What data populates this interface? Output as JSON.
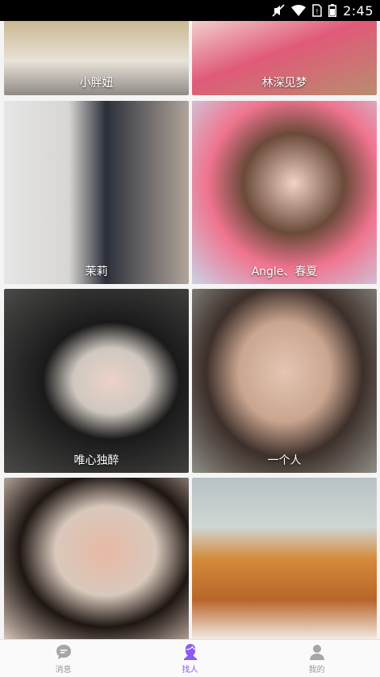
{
  "status_bar": {
    "time": "2:45",
    "icons": [
      "mute-icon",
      "wifi-icon",
      "no-sim-icon",
      "battery-icon"
    ]
  },
  "profiles": [
    {
      "name": "小胖妞",
      "photo_colors": [
        "#c9b68e",
        "#e8e2d8",
        "#8f8a86"
      ]
    },
    {
      "name": "林深见梦",
      "photo_colors": [
        "#f2d1cf",
        "#e05a78",
        "#b98d6f"
      ]
    },
    {
      "name": "茉莉",
      "photo_colors": [
        "#e6e6e6",
        "#2b2f3a",
        "#b0a49a"
      ]
    },
    {
      "name": "Angle、春夏",
      "photo_colors": [
        "#f0748f",
        "#c9d2e6",
        "#6b4a3a"
      ]
    },
    {
      "name": "唯心独醉",
      "photo_colors": [
        "#4b4a48",
        "#cfc8c0",
        "#1a1a1a"
      ]
    },
    {
      "name": "一个人",
      "photo_colors": [
        "#8e8e86",
        "#e4c6b2",
        "#3d2f2a"
      ]
    },
    {
      "name": "",
      "photo_colors": [
        "#d9c8bc",
        "#e7b9a4",
        "#1e1612"
      ]
    },
    {
      "name": "",
      "photo_colors": [
        "#b8c2c4",
        "#d48a3a",
        "#f5f0ea"
      ]
    }
  ],
  "tabs": [
    {
      "label": "消息",
      "icon": "message-icon",
      "active": false
    },
    {
      "label": "找人",
      "icon": "find-people-icon",
      "active": true
    },
    {
      "label": "我的",
      "icon": "profile-icon",
      "active": false
    }
  ],
  "colors": {
    "accent": "#8a5cf5",
    "inactive": "#9a9a9a",
    "status_bar": "#000000"
  }
}
